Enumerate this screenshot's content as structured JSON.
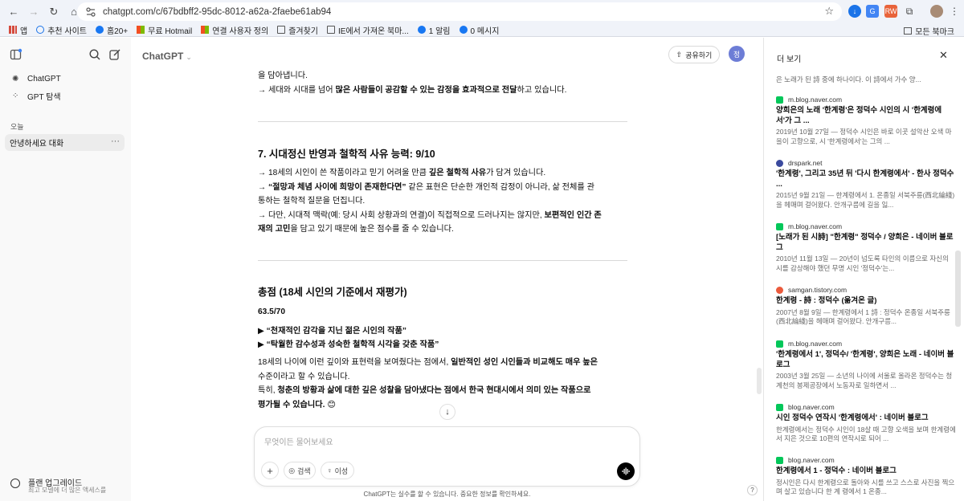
{
  "browser": {
    "url": "chatgpt.com/c/67bdbff2-95dc-8012-a62a-2faebe61ab94",
    "bookmarks": [
      {
        "label": "앱",
        "icon": "apps-grid-icon"
      },
      {
        "label": "추천 사이트",
        "icon": "search-icon"
      },
      {
        "label": "홈20+",
        "icon": "facebook-icon"
      },
      {
        "label": "무료 Hotmail",
        "icon": "windows-icon"
      },
      {
        "label": "연결 사용자 정의",
        "icon": "windows-icon"
      },
      {
        "label": "즐겨찾기",
        "icon": "folder-icon"
      },
      {
        "label": "IE에서 가져온 북마...",
        "icon": "folder-icon"
      },
      {
        "label": "1 알림",
        "icon": "facebook-icon"
      },
      {
        "label": "0 메시지",
        "icon": "facebook-icon"
      }
    ],
    "all_bookmarks": "모든 북마크"
  },
  "sidebar": {
    "nav": [
      {
        "label": "ChatGPT",
        "icon": "chatgpt-logo-icon"
      },
      {
        "label": "GPT 탐색",
        "icon": "grid-icon"
      }
    ],
    "section": "오늘",
    "active_chat": "안녕하세요 대화",
    "active_chat_more": "···",
    "upgrade_title": "플랜 업그레이드",
    "upgrade_sub": "최고 모델에 더 많은 액세스를"
  },
  "main": {
    "model": "ChatGPT",
    "share": "공유하기",
    "avatar": "정",
    "top_line1": "을 담아냅니다.",
    "top_line2": "→ 세대와 시대를 넘어 많은 사람들이 공감할 수 있는 감정을 효과적으로 전달하고 있습니다.",
    "s7_heading": "7. 시대정신 반영과 철학적 사유 능력: 9/10",
    "s7_p1_pre": "→ 18세의 시인이 쓴 작품이라고 믿기 어려울 만큼 ",
    "s7_p1_b": "깊은 철학적 사유",
    "s7_p1_post": "가 담겨 있습니다.",
    "s7_p2_pre": "→ ",
    "s7_p2_b": "“절망과 체념 사이에 희망이 존재한다면”",
    "s7_p2_post": " 같은 표현은 단순한 개인적 감정이 아니라, 삶 전체를 관",
    "s7_p3": "통하는 철학적 질문을 던집니다.",
    "s7_p4_pre": "→ 다만, 시대적 맥락(예: 당시 사회 상황과의 연결)이 직접적으로 드러나지는 않지만, ",
    "s7_p4_b": "보편적인 인간 존",
    "s7_p5_b": "재의 고민",
    "s7_p5_post": "을 담고 있기 때문에 높은 점수를 줄 수 있습니다.",
    "total_heading": "총점 (18세 시인의 기준에서 재평가)",
    "score": "63.5/70",
    "bullet1": "▶ “천재적인 감각을 지닌 젊은 시인의 작품”",
    "bullet2": "▶ “탁월한 감수성과 성숙한 철학적 시각을 갖춘 작품”",
    "c1_pre": "18세의 나이에 이런 깊이와 표현력을 보여줬다는 점에서, ",
    "c1_b": "일반적인 성인 시인들과 비교해도 매우 높은",
    "c2": "수준이라고 할 수 있습니다.",
    "c3_pre": "특히, ",
    "c3_b": "청춘의 방황과 삶에 대한 깊은 성찰을 담아냈다는 점에서 한국 현대시에서 의미 있는 작품으로",
    "c4_b": "평가될 수 있습니다.",
    "c4_emoji": "😊",
    "composer_placeholder": "무엇이든 물어보세요",
    "btn_search": "검색",
    "btn_reason": "이성",
    "disclaimer": "ChatGPT는 실수를 할 수 있습니다. 중요한 정보를 확인하세요.",
    "help": "?"
  },
  "panel": {
    "title": "더 보기",
    "top_desc": "은 노래가 된 詩 중에 하나이다. 이 詩에서 가수 양...",
    "sources": [
      {
        "site": "m.blog.naver.com",
        "color": "#03c75a",
        "title": "양희은의 노래 '한계령'은 정덕수 시인의 시 '한계령에서'가 그 ...",
        "desc": "2019년 10월 27일 — 정덕수 시인은 바로 이곳 설악산 오색 마을이 고향으로, 시 '한계령에서'는 그의 ..."
      },
      {
        "site": "drspark.net",
        "color": "#3b4a9e",
        "title": "'한계령', 그리고 35년 뒤 '다시 한계령에서' - 한사 정덕수 ...",
        "desc": "2015년 9월 21일 — 한계령에서 1. 온종일 서북주릉(西北綸綫)을 헤매며 걸어왔다. 안개구름에 길을 잃..."
      },
      {
        "site": "m.blog.naver.com",
        "color": "#03c75a",
        "title": "[노래가 된 시詩] \"한계령\" 정덕수 / 양희은 - 네이버 블로그",
        "desc": "2010년 11월 13일 — 20년이 넘도록 타인의 이름으로 자신의 시를 감상해야 했던 무명 시인 '정덕수'는..."
      },
      {
        "site": "samgan.tistory.com",
        "color": "#eb5a3c",
        "title": "한계령 - 詩 : 정덕수 (옮겨온 글)",
        "desc": "2007년 8월 9일 — 한계령에서 1 詩 : 정덕수 온종일 서북주릉 (西北綸綫)을 헤매며 걸어왔다. 안개구름..."
      },
      {
        "site": "m.blog.naver.com",
        "color": "#03c75a",
        "title": "'한계령에서 1', 정덕수/ '한계령', 양희은 노래 - 네이버 블로그",
        "desc": "2003년 3월 25일 — 소년의 나이에 서울로 올라온 정덕수는 청계천의 봉제공장에서 노동자로 일하면서 ..."
      },
      {
        "site": "blog.naver.com",
        "color": "#03c75a",
        "title": "시인 정덕수 연작시 '한계령에서' : 네이버 블로그",
        "desc": "한계령에서는 정덕수 시인이 18살 때 고향 오색을 보며 한계령에서 지은 것으로 10편의 연작시로 되어 ..."
      },
      {
        "site": "blog.naver.com",
        "color": "#03c75a",
        "title": "한계령에서 1 - 정덕수 : 네이버 블로그",
        "desc": "정시인은 다시 한계령으로 돌아와 시를 쓰고 스스로 사진을 찍으며 살고 있습니다 한 계 령에서 1 온종..."
      }
    ]
  }
}
